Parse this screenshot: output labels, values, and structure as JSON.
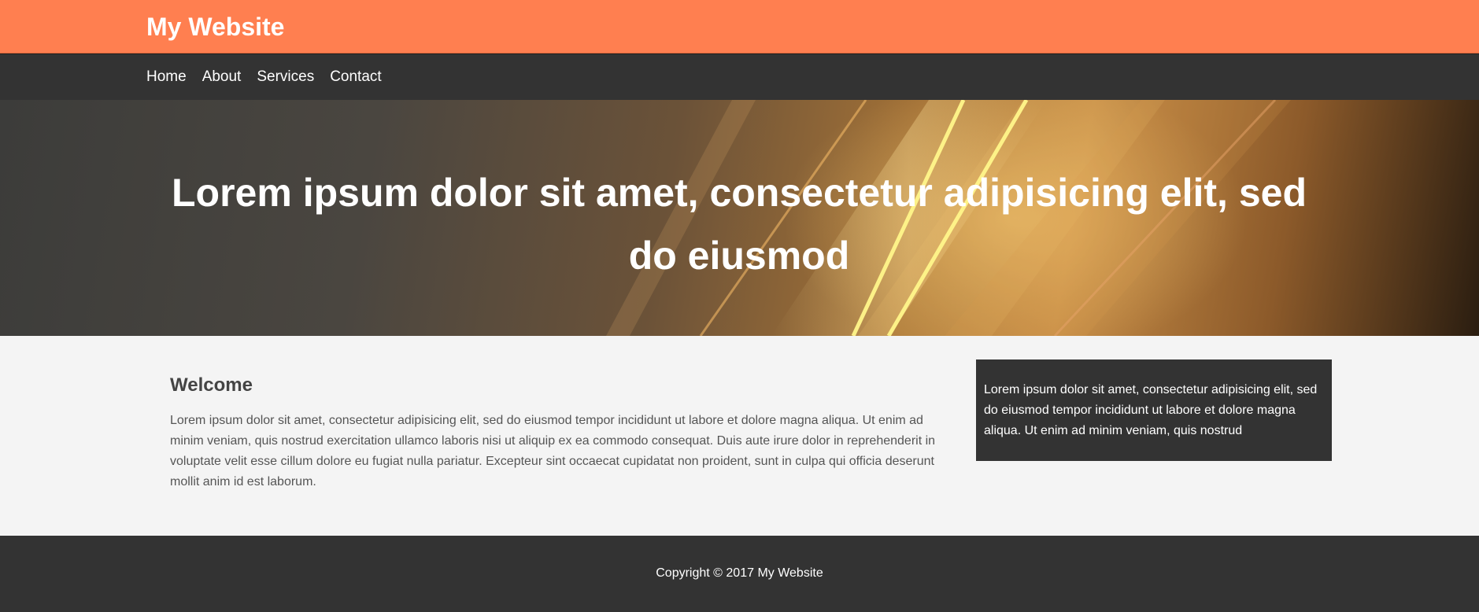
{
  "header": {
    "site_title": "My Website",
    "color": "#ff7f50"
  },
  "nav": {
    "items": [
      {
        "label": "Home"
      },
      {
        "label": "About"
      },
      {
        "label": "Services"
      },
      {
        "label": "Contact"
      }
    ],
    "color": "#333333"
  },
  "hero": {
    "heading": "Lorem ipsum dolor sit amet, consectetur adipisicing elit, sed do eiusmod"
  },
  "main": {
    "welcome_heading": "Welcome",
    "welcome_text": "Lorem ipsum dolor sit amet, consectetur adipisicing elit, sed do eiusmod tempor incididunt ut labore et dolore magna aliqua. Ut enim ad minim veniam, quis nostrud exercitation ullamco laboris nisi ut aliquip ex ea commodo consequat. Duis aute irure dolor in reprehenderit in voluptate velit esse cillum dolore eu fugiat nulla pariatur. Excepteur sint occaecat cupidatat non proident, sunt in culpa qui officia deserunt mollit anim id est laborum.",
    "sidebar_text": "Lorem ipsum dolor sit amet, consectetur adipisicing elit, sed do eiusmod tempor incididunt ut labore et dolore magna aliqua. Ut enim ad minim veniam, quis nostrud"
  },
  "footer": {
    "copyright": "Copyright © 2017 My Website"
  }
}
